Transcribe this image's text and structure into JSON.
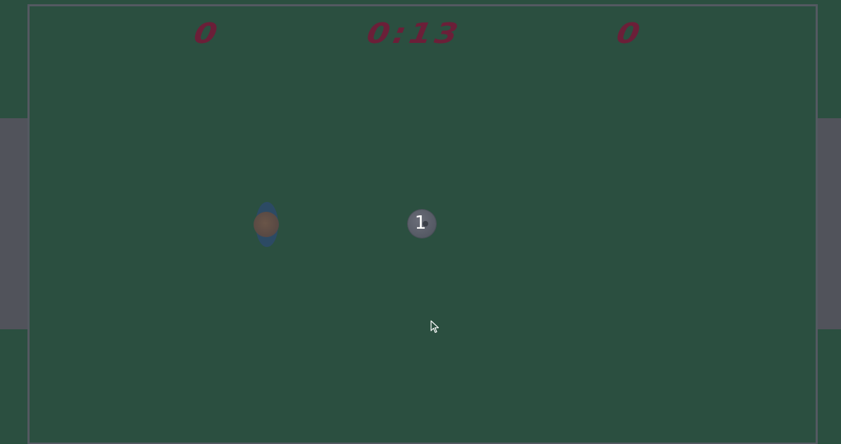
{
  "scoreboard": {
    "home_score": "0",
    "away_score": "0",
    "timer": "0:13"
  },
  "ball": {
    "label": "1"
  },
  "colors": {
    "field": "#2b4f40",
    "field_border": "#545961",
    "goal": "#51535b",
    "scoreboard_text": "#6b1f38",
    "player_shadow": "#2c4a66",
    "player_body": "#5a4a44",
    "ball": "#555964",
    "ball_text": "#ffffff"
  },
  "icons": {
    "cursor": "mouse-pointer-icon"
  }
}
